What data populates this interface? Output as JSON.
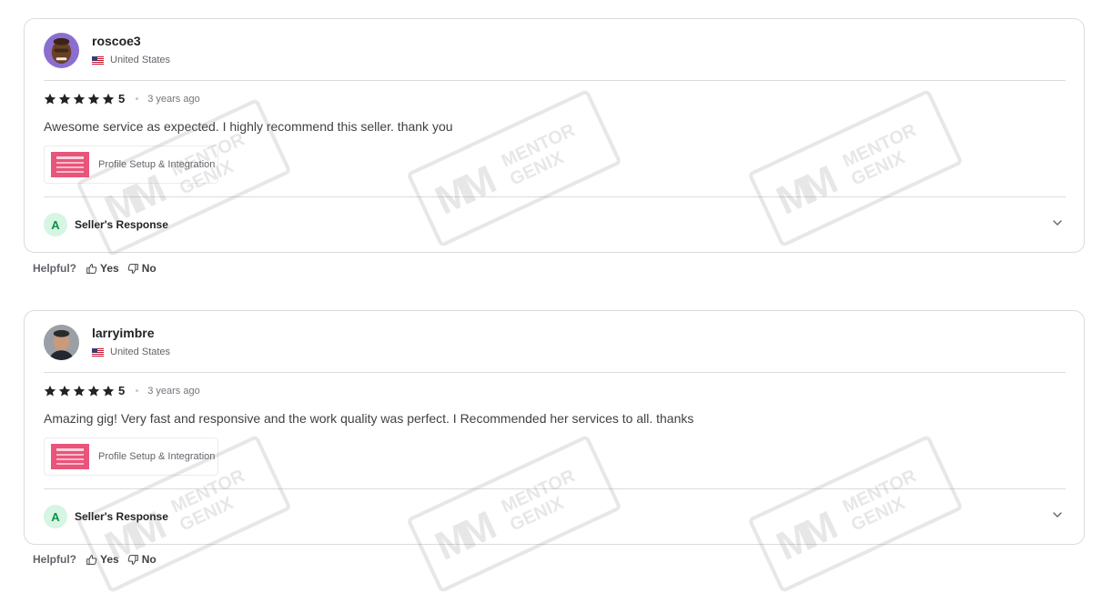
{
  "reviews": [
    {
      "username": "roscoe3",
      "country": "United States",
      "rating": "5",
      "stars": 5,
      "time": "3 years ago",
      "text": "Awesome service as expected. I highly recommend this seller. thank you",
      "gig_title": "Profile Setup & Integration",
      "response_avatar": "A",
      "response_label": "Seller's Response"
    },
    {
      "username": "larryimbre",
      "country": "United States",
      "rating": "5",
      "stars": 5,
      "time": "3 years ago",
      "text": "Amazing gig! Very fast and responsive and the work quality was perfect. I Recommended her services to all. thanks",
      "gig_title": "Profile Setup & Integration",
      "response_avatar": "A",
      "response_label": "Seller's Response"
    }
  ],
  "helpful": {
    "label": "Helpful?",
    "yes": "Yes",
    "no": "No"
  },
  "watermark": {
    "mark": "MM",
    "line1": "MENTOR",
    "line2": "GENIX"
  },
  "colors": {
    "star": "#222325",
    "response_badge_bg": "#d6f5e3",
    "response_badge_text": "#0e8f4b",
    "gig_thumb": "#e8547a"
  },
  "icons": {
    "star": "star-icon",
    "flag": "us-flag-icon",
    "chevron": "chevron-down-icon",
    "thumbs_up": "thumbs-up-icon",
    "thumbs_down": "thumbs-down-icon"
  }
}
